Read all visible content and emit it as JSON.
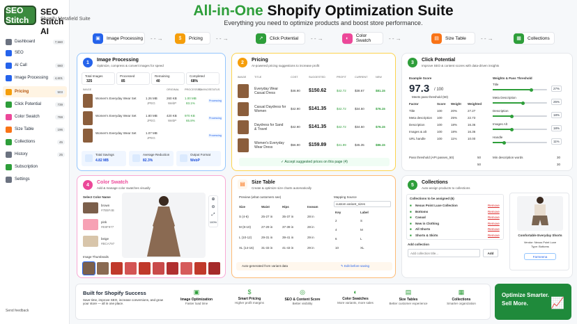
{
  "app": {
    "logo_text": "SEO Stitch",
    "title": "SEO Stitch AI",
    "subtitle": "Shopify Metafield Suite"
  },
  "sidebar": {
    "items": [
      {
        "label": "Dashboard",
        "count": "7,560",
        "color": "#6b7280"
      },
      {
        "label": "SEO",
        "count": "",
        "color": "#2563eb"
      },
      {
        "label": "AI Call",
        "count": "660",
        "color": "#2563eb"
      },
      {
        "label": "Image Processing",
        "count": "4,601",
        "color": "#2563eb"
      },
      {
        "label": "Pricing",
        "count": "503",
        "color": "#f59e0b"
      },
      {
        "label": "Click Potential",
        "count": "739",
        "color": "#2e9e3a"
      },
      {
        "label": "Color Swatch",
        "count": "769",
        "color": "#ec4899"
      },
      {
        "label": "Size Table",
        "count": "196",
        "color": "#f97316"
      },
      {
        "label": "Collections",
        "count": "45",
        "color": "#2e9e3a"
      },
      {
        "label": "History",
        "count": "25",
        "color": "#6b7280"
      },
      {
        "label": "Subscription",
        "count": "",
        "color": "#2e9e3a"
      },
      {
        "label": "Settings",
        "count": "",
        "color": "#6b7280"
      }
    ],
    "feedback": "Send feedback"
  },
  "header": {
    "title_green": "All-in-One",
    "title_rest": " Shopify Optimization Suite",
    "subtitle": "Everything you need to optimize products and boost store performance."
  },
  "steps": [
    {
      "label": "Image Processing",
      "color": "#2563eb",
      "icon": "▣"
    },
    {
      "label": "Pricing",
      "color": "#f59e0b",
      "icon": "$"
    },
    {
      "label": "Click Potential",
      "color": "#2e9e3a",
      "icon": "↗"
    },
    {
      "label": "Color Swatch",
      "color": "#ec4899",
      "icon": "◐"
    },
    {
      "label": "Size Table",
      "color": "#f97316",
      "icon": "▤"
    },
    {
      "label": "Collections",
      "color": "#2e9e3a",
      "icon": "▦"
    }
  ],
  "image_processing": {
    "num": "1",
    "title": "Image Processing",
    "subtitle": "Optimize, compress & convert images for speed",
    "stats": [
      {
        "label": "Total Images",
        "value": "325"
      },
      {
        "label": "Processed",
        "value": "85"
      },
      {
        "label": "Remaining",
        "value": "40"
      },
      {
        "label": "Completed",
        "value": "68%"
      }
    ],
    "headers": [
      "IMAGE",
      "",
      "ORIGINAL",
      "PROCESSED",
      "SAVINGS",
      "STATUS"
    ],
    "rows": [
      {
        "name": "Women's Everyday Wear Set",
        "orig": "1.26 MB",
        "orig_fmt": "JPEG",
        "proc": "260 KB",
        "proc_fmt": "WebP",
        "save": "1.00 MB",
        "pct": "83.1%",
        "status": "Processing"
      },
      {
        "name": "Women's Everyday Wear Set",
        "orig": "1.80 MB",
        "orig_fmt": "JPEG",
        "proc": "420 KB",
        "proc_fmt": "WebP",
        "save": "970 KB",
        "pct": "65.8%",
        "status": "Processing"
      },
      {
        "name": "Women's Everyday Wear Set",
        "orig": "1.07 MB",
        "orig_fmt": "JPEG",
        "proc": "",
        "proc_fmt": "",
        "save": "",
        "pct": "",
        "status": "Processing"
      }
    ],
    "footer": [
      {
        "label": "Total Savings",
        "value": "4.82 MB"
      },
      {
        "label": "Average Reduction",
        "value": "82.3%"
      },
      {
        "label": "Output Format",
        "value": "WebP"
      }
    ]
  },
  "pricing": {
    "num": "2",
    "title": "Pricing",
    "subtitle": "AI-powered pricing suggestions to increase profit",
    "headers": [
      "IMAGE",
      "TITLE",
      "COST",
      "SUGGESTED",
      "PROFIT",
      "CURRENT",
      "NEW"
    ],
    "rows": [
      {
        "title": "Everyday Wear Casual Dress",
        "cost": "$46.90",
        "sugg": "$150.62",
        "profit": "$42.72",
        "cur": "$38.67",
        "new": "$81.15"
      },
      {
        "title": "Casual Daydress for Women",
        "cost": "$42.90",
        "sugg": "$141.35",
        "profit": "$42.72",
        "cur": "$34.50",
        "new": "$76.15"
      },
      {
        "title": "Daydress for Sand & Travel",
        "cost": "$42.90",
        "sugg": "$141.35",
        "profit": "$42.72",
        "cur": "$34.50",
        "new": "$76.15"
      },
      {
        "title": "Women's Everyday Wear Dress",
        "cost": "$56.90",
        "sugg": "$159.89",
        "profit": "$41.99",
        "cur": "$45.35",
        "new": "$86.15"
      }
    ],
    "accept": "Accept suggested prices on this page (4)"
  },
  "click_potential": {
    "num": "3",
    "title": "Click Potential",
    "subtitle": "Improve SEO & content scores with data-driven insights",
    "score_label": "Example Score",
    "score": "97.3",
    "score_max": "/ 100",
    "threshold_note": "Meets pass threshold (50)",
    "weights_title": "Weights & Pass Threshold",
    "headers": [
      "Factor",
      "Score",
      "Weight",
      "Weighted"
    ],
    "rows": [
      [
        "Title",
        "100",
        "20%",
        "27.27"
      ],
      [
        "Meta description",
        "100",
        "25%",
        "22.73"
      ],
      [
        "Description",
        "100",
        "18%",
        "16.36"
      ],
      [
        "Images & alt",
        "100",
        "18%",
        "16.36"
      ],
      [
        "URL handle",
        "100",
        "11%",
        "10.00"
      ]
    ],
    "sliders": [
      {
        "label": "Title",
        "pct": "27%",
        "fill": 0.7
      },
      {
        "label": "Meta Description",
        "pct": "25%",
        "fill": 0.55
      },
      {
        "label": "Description",
        "pct": "18%",
        "fill": 0.35
      },
      {
        "label": "Images Alt",
        "pct": "18%",
        "fill": 0.35
      },
      {
        "label": "Handle",
        "pct": "11%",
        "fill": 0.2
      }
    ],
    "pass_label": "Pass threshold (API passes_50)",
    "pass_value": "50",
    "min_desc_label": "Min description words",
    "min_desc_value": "30",
    "val2a": "50",
    "val2b": "30"
  },
  "color_swatch": {
    "num": "4",
    "title": "Color Swatch",
    "title_pre": "",
    "subtitle": "Add & manage color swatches visually",
    "label": "Select Color Name",
    "swatches": [
      {
        "name": "brown",
        "hex": "#7B5F4B",
        "color": "#7b5f4b"
      },
      {
        "name": "pink",
        "hex": "#E8F977",
        "color": "#f7a1b4"
      },
      {
        "name": "beige",
        "hex": "#BCA797",
        "color": "#d8c5aa"
      }
    ],
    "thumbs_label": "Image Thumbnails",
    "zoom": "100%"
  },
  "size_table": {
    "title": "Size Table",
    "subtitle": "Create & optimize size charts automatically",
    "preview": "Preview (what customers see)",
    "headers": [
      "Size",
      "Waist",
      "Hips",
      "Inseam"
    ],
    "rows": [
      [
        "S (4-6)",
        "25-27 in",
        "35-37 in",
        "28 in"
      ],
      [
        "M (8-10)",
        "27-29 in",
        "37-39 in",
        "28 in"
      ],
      [
        "L (10-12)",
        "29-31 in",
        "39-41 in",
        "29 in"
      ],
      [
        "XL (14-16)",
        "31-33 in",
        "41-43 in",
        "29 in"
      ]
    ],
    "mapping_label": "Mapping Source",
    "mapping_value": "custom.variant_sizes",
    "map_headers": [
      "Key",
      "Label"
    ],
    "map_rows": [
      [
        "2",
        "S"
      ],
      [
        "4",
        "M"
      ],
      [
        "6",
        "L"
      ],
      [
        "10",
        "XL"
      ]
    ],
    "auto": "Auto-generated from variant data",
    "edit": "Edit before saving"
  },
  "collections": {
    "num": "5",
    "title": "Collections",
    "subtitle": "Auto-assign products to collections",
    "assigned": "Collections to be assigned (6)",
    "items": [
      "Nexus Point Luxe Collection",
      "Bottoms",
      "Casual",
      "New in Clothing",
      "All Shorts",
      "Shorts & Skirts"
    ],
    "remove": "Remove",
    "add_label": "Add collection",
    "add_placeholder": "Add collection title...",
    "add_btn": "Add",
    "product": "Comfortable Everyday Shorts",
    "vendor": "Vendor: Nexus Point Luxe",
    "type": "Type: Bottoms",
    "tag": "Farmeena"
  },
  "bottom": {
    "title": "Built for Shopify Success",
    "desc": "Save time, improve SEO, increase conversions, and grow your store — all in one place.",
    "features": [
      {
        "t": "Image Optimization",
        "d": "Faster load time",
        "i": "▣"
      },
      {
        "t": "Smart Pricing",
        "d": "Higher profit margins",
        "i": "$"
      },
      {
        "t": "SEO & Content Score",
        "d": "Better visibility",
        "i": "◎"
      },
      {
        "t": "Color Swatches",
        "d": "More variants, more sales",
        "i": "◐"
      },
      {
        "t": "Size Tables",
        "d": "Better customer experience",
        "i": "▤"
      },
      {
        "t": "Collections",
        "d": "Smarter organization",
        "i": "▦"
      }
    ]
  },
  "cta": {
    "line1": "Optimize Smarter.",
    "line2": "Sell More."
  }
}
